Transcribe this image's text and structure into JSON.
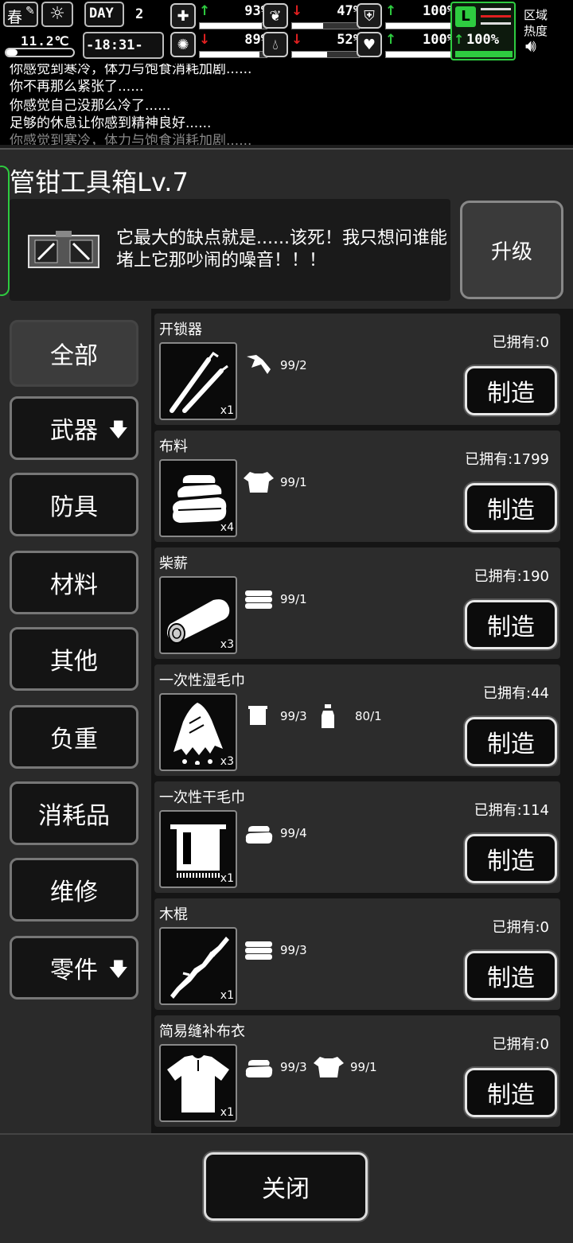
{
  "hud": {
    "season": "春",
    "day_label": "DAY",
    "day_number": "2",
    "temperature": "11.2℃",
    "clock": "-18:31-",
    "stats": [
      {
        "icon": "medkit-icon",
        "direction": "up",
        "value": "93%",
        "level": 0.93
      },
      {
        "icon": "stomach-icon",
        "direction": "down",
        "value": "47%",
        "level": 0.47
      },
      {
        "icon": "shield-icon",
        "direction": "up",
        "value": "100%",
        "level": 1.0
      },
      {
        "icon": "brain-icon",
        "direction": "down",
        "value": "89%",
        "level": 0.89
      },
      {
        "icon": "water-drop-icon",
        "direction": "down",
        "value": "52%",
        "level": 0.52
      },
      {
        "icon": "heart-icon",
        "direction": "up",
        "value": "100%",
        "level": 1.0
      }
    ],
    "stamina": {
      "direction": "up",
      "value": "100%",
      "level": 1.0
    },
    "zone_heat_label_1": "区域",
    "zone_heat_label_2": "热度"
  },
  "log": {
    "lines": [
      "你感觉到寒冷，体力与饱食消耗加剧......",
      "你不再那么紧张了......",
      "你感觉自己没那么冷了......",
      "足够的休息让你感到精神良好......",
      "你感觉到寒冷，体力与饱食消耗加剧......"
    ]
  },
  "station": {
    "title": "管钳工具箱Lv.7",
    "description": "它最大的缺点就是......该死！我只想问谁能堵上它那吵闹的噪音！！！",
    "upgrade_label": "升级"
  },
  "categories": [
    {
      "label": "全部",
      "active": true
    },
    {
      "label": "武器",
      "expand": "🡇"
    },
    {
      "label": "防具"
    },
    {
      "label": "材料"
    },
    {
      "label": "其他"
    },
    {
      "label": "负重"
    },
    {
      "label": "消耗品"
    },
    {
      "label": "维修"
    },
    {
      "label": "零件",
      "expand": "🡇"
    }
  ],
  "recipes": [
    {
      "name": "开锁器",
      "owned": "已拥有:0",
      "qty": "x1",
      "icon": "lockpick-icon",
      "materials": [
        {
          "icon": "scrap-icon",
          "value": "99/2"
        }
      ]
    },
    {
      "name": "布料",
      "owned": "已拥有:1799",
      "qty": "x4",
      "icon": "cloth-icon",
      "materials": [
        {
          "icon": "torn-shirt-icon",
          "value": "99/1"
        }
      ]
    },
    {
      "name": "柴薪",
      "owned": "已拥有:190",
      "qty": "x3",
      "icon": "firewood-icon",
      "materials": [
        {
          "icon": "logs-icon",
          "value": "99/1"
        }
      ]
    },
    {
      "name": "一次性湿毛巾",
      "owned": "已拥有:44",
      "qty": "x3",
      "icon": "wet-towel-icon",
      "materials": [
        {
          "icon": "towel-icon",
          "value": "99/3"
        },
        {
          "icon": "water-bottle-icon",
          "value": "80/1"
        }
      ]
    },
    {
      "name": "一次性干毛巾",
      "owned": "已拥有:114",
      "qty": "x1",
      "icon": "dry-towel-icon",
      "materials": [
        {
          "icon": "cloth-icon",
          "value": "99/4"
        }
      ]
    },
    {
      "name": "木棍",
      "owned": "已拥有:0",
      "qty": "x1",
      "icon": "wooden-stick-icon",
      "materials": [
        {
          "icon": "logs-icon",
          "value": "99/3"
        }
      ]
    },
    {
      "name": "简易缝补布衣",
      "owned": "已拥有:0",
      "qty": "x1",
      "icon": "shirt-icon",
      "materials": [
        {
          "icon": "cloth-icon",
          "value": "99/3"
        },
        {
          "icon": "torn-shirt-icon",
          "value": "99/1"
        }
      ]
    }
  ],
  "craft_label": "制造",
  "close_label": "关闭"
}
